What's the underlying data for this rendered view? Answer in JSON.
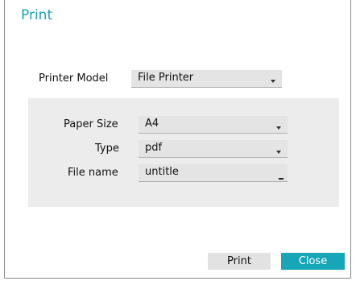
{
  "dialog": {
    "title": "Print",
    "accent_color": "#1aa0b3"
  },
  "printer_model": {
    "label": "Printer Model",
    "value": "File Printer"
  },
  "paper_size": {
    "label": "Paper Size",
    "value": "A4"
  },
  "type": {
    "label": "Type",
    "value": "pdf"
  },
  "file_name": {
    "label": "File name",
    "value": "untitle"
  },
  "buttons": {
    "print": "Print",
    "close": "Close"
  },
  "icons": {
    "dropdown": "chevron-down-icon"
  }
}
